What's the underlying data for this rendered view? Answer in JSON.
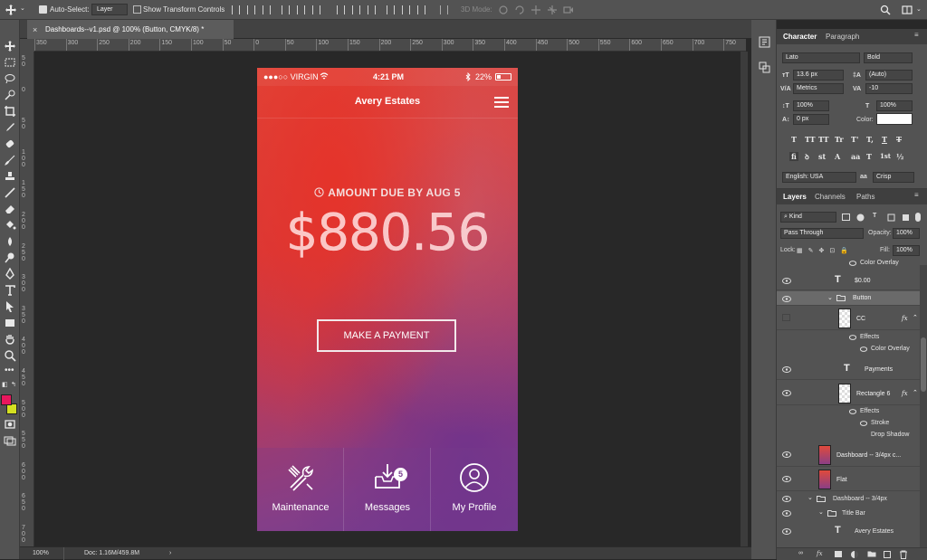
{
  "options_bar": {
    "auto_select_label": "Auto-Select:",
    "auto_select_target": "Layer",
    "show_transform_label": "Show Transform Controls",
    "mode_3d_label": "3D Mode:"
  },
  "document": {
    "tab_title": "Dashboards--v1.psd @ 100% (Button, CMYK/8) *",
    "close_glyph": "×"
  },
  "rulers": {
    "h_ticks": [
      "350",
      "300",
      "250",
      "200",
      "150",
      "100",
      "50",
      "0",
      "50",
      "100",
      "150",
      "200",
      "250",
      "300",
      "350",
      "400",
      "450",
      "500",
      "550",
      "600",
      "650",
      "700",
      "750"
    ],
    "v_ticks": [
      "5\n0",
      "0",
      "5\n0",
      "1\n0\n0",
      "1\n5\n0",
      "2\n0\n0",
      "2\n5\n0",
      "3\n0\n0",
      "3\n5\n0",
      "4\n0\n0",
      "4\n5\n0",
      "5\n0\n0",
      "5\n5\n0",
      "6\n0\n0",
      "6\n5\n0",
      "7\n0\n0",
      "7\n5\n0"
    ]
  },
  "status": {
    "zoom": "100%",
    "doc_size": "Doc: 1.16M/459.8M",
    "arrow": "›"
  },
  "phone": {
    "carrier": "●●●○○ VIRGIN",
    "time": "4:21 PM",
    "battery": "22%",
    "title": "Avery Estates",
    "due_label": "AMOUNT DUE BY AUG 5",
    "amount": "$880.56",
    "pay_button": "MAKE A PAYMENT",
    "tabs": [
      {
        "label": "Maintenance",
        "icon": "tools-icon"
      },
      {
        "label": "Messages",
        "icon": "inbox-icon",
        "badge": "5"
      },
      {
        "label": "My Profile",
        "icon": "user-icon"
      }
    ]
  },
  "character_panel": {
    "tabs": [
      "Character",
      "Paragraph"
    ],
    "font_family": "Lato",
    "font_style": "Bold",
    "font_size": "13.6 px",
    "leading": "(Auto)",
    "kerning": "Metrics",
    "tracking": "-10",
    "vscale": "100%",
    "hscale": "100%",
    "baseline": "0 px",
    "color_label": "Color:",
    "language": "English: USA",
    "aa_label": "aa",
    "antialias": "Crisp",
    "type_row1": [
      "T",
      "TT",
      "TT",
      "Tr",
      "T'",
      "T,",
      "T",
      "T"
    ],
    "type_row2": [
      "fi",
      "ꝺ",
      "st",
      "A",
      "aa",
      "T",
      "1st",
      "½"
    ]
  },
  "layers_panel": {
    "tabs": [
      "Layers",
      "Channels",
      "Paths"
    ],
    "filter_kind": "Kind",
    "blend_mode": "Pass Through",
    "opacity_label": "Opacity:",
    "opacity": "100%",
    "lock_label": "Lock:",
    "fill_label": "Fill:",
    "fill": "100%",
    "rows": {
      "color_overlay_top": "Color Overlay",
      "text_zero": "$0.00",
      "button_group": "Button",
      "cc": "CC",
      "effects1": "Effects",
      "color_overlay2": "Color Overlay",
      "payments": "Payments",
      "rect6": "Rectangle 6",
      "effects2": "Effects",
      "stroke": "Stroke",
      "drop_shadow": "Drop Shadow",
      "dash_copy": "Dashboard -- 3/4px c...",
      "flat": "Flat",
      "dash_group": "Dashboard -- 3/4px",
      "title_bar": "Title Bar",
      "avery": "Avery Estates"
    },
    "fx_label": "fx"
  },
  "colors": {
    "foreground": "#e8175d",
    "background": "#d4e021",
    "text_color_swatch": "#ffffff"
  }
}
